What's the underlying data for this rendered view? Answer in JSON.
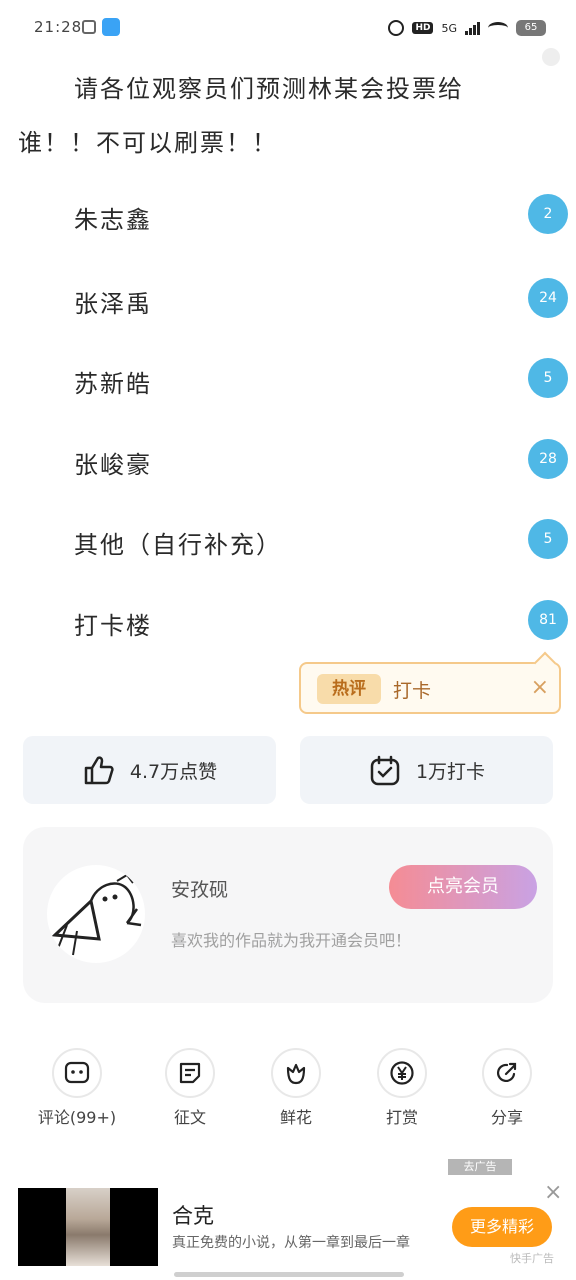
{
  "status_bar": {
    "time": "21:28",
    "network": "5G",
    "hd": "HD",
    "battery": "65"
  },
  "post": {
    "title": "请各位观察员们预测林某会投票给谁！！不可以刷票！！"
  },
  "options": [
    {
      "label": "朱志鑫",
      "count": "2"
    },
    {
      "label": "张泽禹",
      "count": "24"
    },
    {
      "label": "苏新皓",
      "count": "5"
    },
    {
      "label": "张峻豪",
      "count": "28"
    },
    {
      "label": "其他（自行补充）",
      "count": "5"
    },
    {
      "label": "打卡楼",
      "count": "81"
    }
  ],
  "hot_comment": {
    "tag": "热评",
    "text": "打卡",
    "close": "×"
  },
  "actions": {
    "like_label": "4.7万点赞",
    "checkin_label": "1万打卡"
  },
  "member_card": {
    "author": "安孜砚",
    "button": "点亮会员",
    "description": "喜欢我的作品就为我开通会员吧！"
  },
  "bottom_bar": [
    {
      "label": "评论(99+)",
      "icon": "comment-icon"
    },
    {
      "label": "征文",
      "icon": "document-icon"
    },
    {
      "label": "鲜花",
      "icon": "flower-icon"
    },
    {
      "label": "打赏",
      "icon": "yen-icon"
    },
    {
      "label": "分享",
      "icon": "share-icon"
    }
  ],
  "ad": {
    "badge": "去广告",
    "title": "合克",
    "description": "真正免费的小说，从第一章到最后一章",
    "cta": "更多精彩",
    "close": "×",
    "source": "快手广告"
  },
  "colors": {
    "count_badge": "#4fb8e6",
    "hot_border": "#f5c98a",
    "cta_orange": "#ff9c17"
  }
}
